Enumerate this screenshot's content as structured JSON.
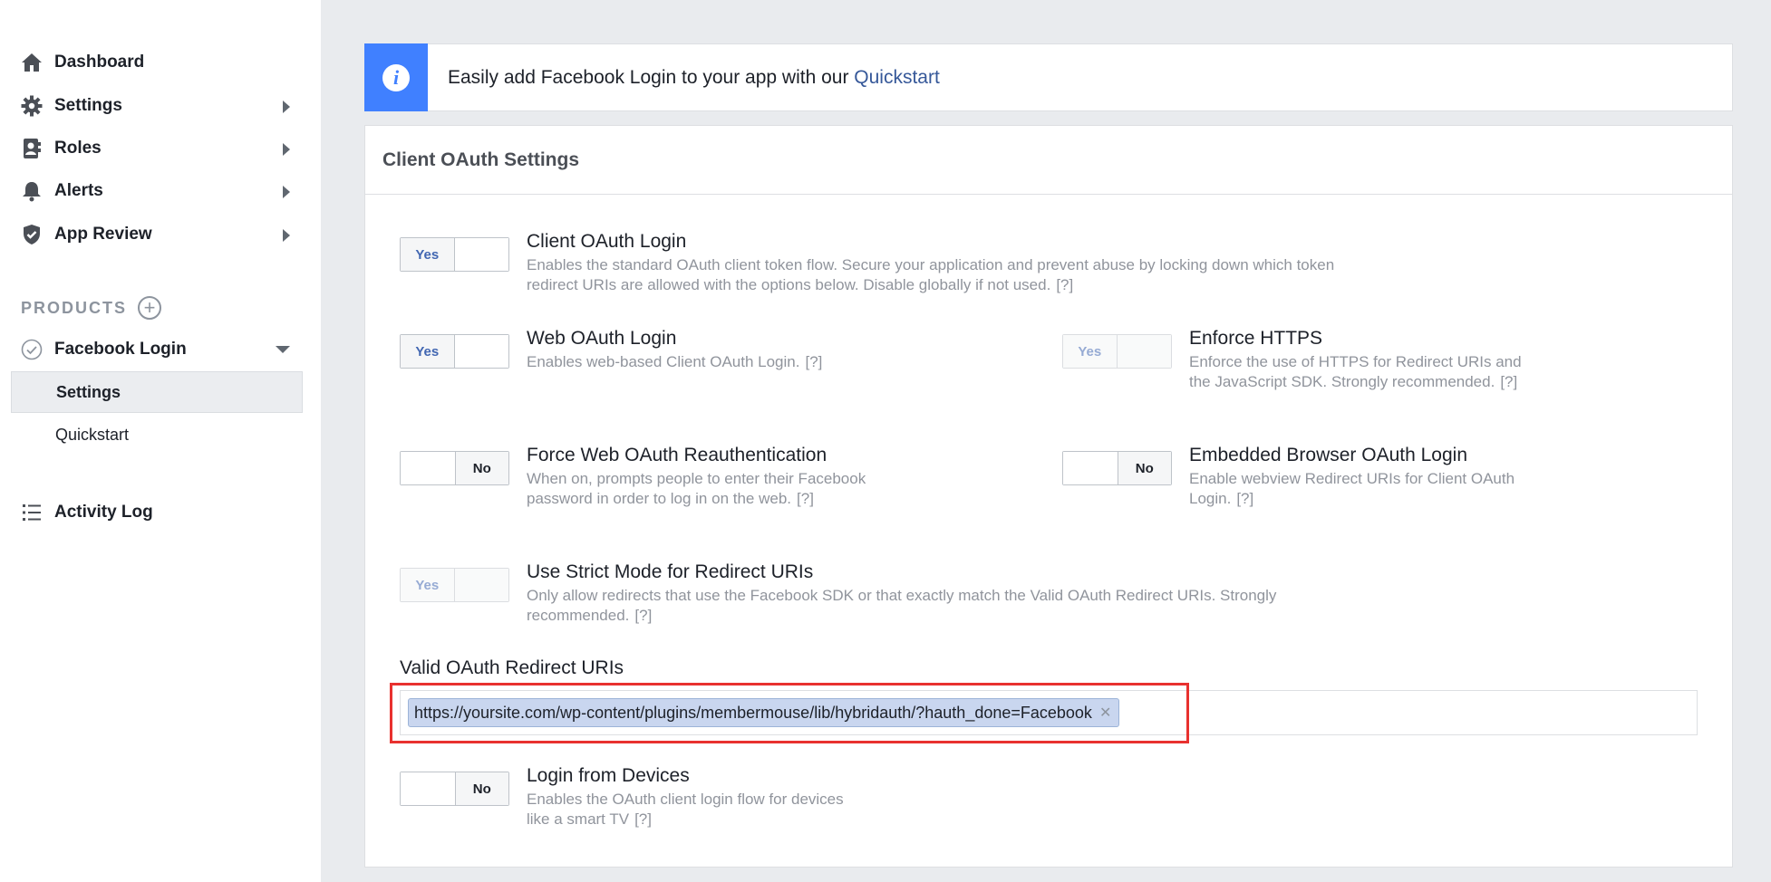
{
  "sidebar": {
    "items": [
      {
        "label": "Dashboard"
      },
      {
        "label": "Settings"
      },
      {
        "label": "Roles"
      },
      {
        "label": "Alerts"
      },
      {
        "label": "App Review"
      }
    ],
    "products_label": "PRODUCTS",
    "product": {
      "label": "Facebook Login"
    },
    "subitems": [
      {
        "label": "Settings"
      },
      {
        "label": "Quickstart"
      }
    ],
    "activity_log": "Activity Log"
  },
  "banner": {
    "text": "Easily add Facebook Login to your app with our ",
    "link": "Quickstart"
  },
  "card": {
    "title": "Client OAuth Settings"
  },
  "settings": {
    "client_oauth": {
      "title": "Client OAuth Login",
      "desc": "Enables the standard OAuth client token flow. Secure your application and prevent abuse by locking down which token redirect URIs are allowed with the options below. Disable globally if not used.",
      "state": "Yes"
    },
    "web_oauth": {
      "title": "Web OAuth Login",
      "desc": "Enables web-based Client OAuth Login.",
      "state": "Yes"
    },
    "enforce_https": {
      "title": "Enforce HTTPS",
      "desc": "Enforce the use of HTTPS for Redirect URIs and the JavaScript SDK. Strongly recommended.",
      "state": "Yes"
    },
    "force_reauth": {
      "title": "Force Web OAuth Reauthentication",
      "desc": "When on, prompts people to enter their Facebook password in order to log in on the web.",
      "state": "No"
    },
    "embedded_browser": {
      "title": "Embedded Browser OAuth Login",
      "desc": "Enable webview Redirect URIs for Client OAuth Login.",
      "state": "No"
    },
    "strict_mode": {
      "title": "Use Strict Mode for Redirect URIs",
      "desc": "Only allow redirects that use the Facebook SDK or that exactly match the Valid OAuth Redirect URIs. Strongly recommended.",
      "state": "Yes"
    },
    "login_devices": {
      "title": "Login from Devices",
      "desc": "Enables the OAuth client login flow for devices like a smart TV",
      "state": "No"
    }
  },
  "help_label": "[?]",
  "redirect_uris": {
    "label": "Valid OAuth Redirect URIs",
    "tokens": [
      "https://yoursite.com/wp-content/plugins/membermouse/lib/hybridauth/?hauth_done=Facebook"
    ],
    "remove_glyph": "✕"
  },
  "colors": {
    "accent": "#4080ff",
    "link": "#365899",
    "highlight": "#e8312f"
  }
}
